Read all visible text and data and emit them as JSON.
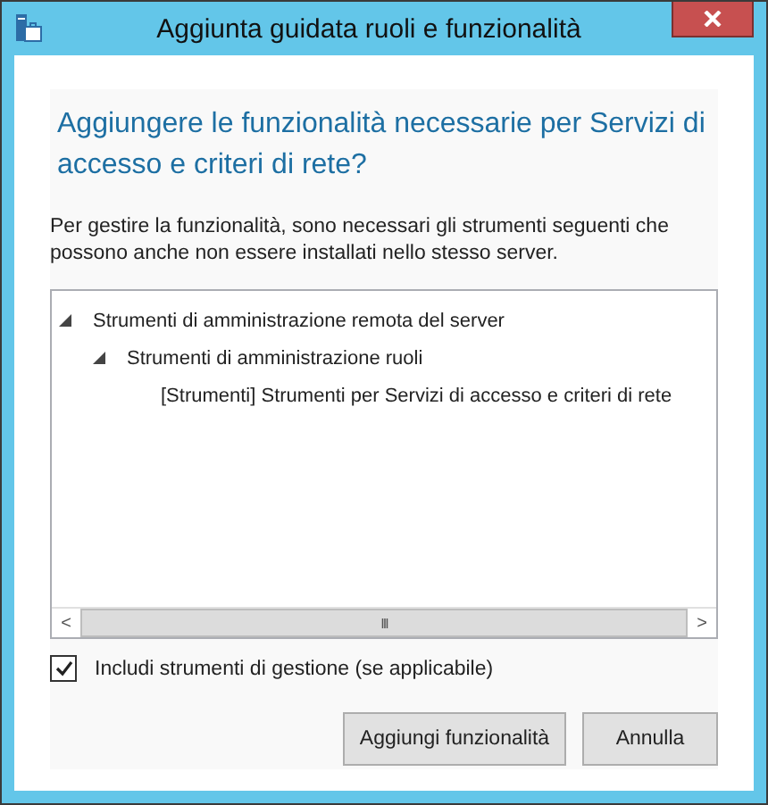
{
  "window": {
    "title": "Aggiunta guidata ruoli e funzionalità"
  },
  "heading": "Aggiungere le funzionalità necessarie per Servizi di accesso e criteri di rete?",
  "description": "Per gestire la funzionalità, sono necessari gli strumenti seguenti che possono anche non essere installati nello stesso server.",
  "tree": [
    {
      "label": "Strumenti di amministrazione remota del server",
      "expanded": true,
      "children": [
        {
          "label": "Strumenti di amministrazione ruoli",
          "expanded": true,
          "children": [
            {
              "label": "[Strumenti] Strumenti per Servizi di accesso e criteri di rete"
            }
          ]
        }
      ]
    }
  ],
  "scrollbar": {
    "thumb_glyph": "III",
    "left_glyph": "<",
    "right_glyph": ">"
  },
  "checkbox": {
    "label": "Includi strumenti di gestione (se applicabile)",
    "checked": true
  },
  "buttons": [
    {
      "label": "Aggiungi funzionalità"
    },
    {
      "label": "Annulla"
    }
  ]
}
